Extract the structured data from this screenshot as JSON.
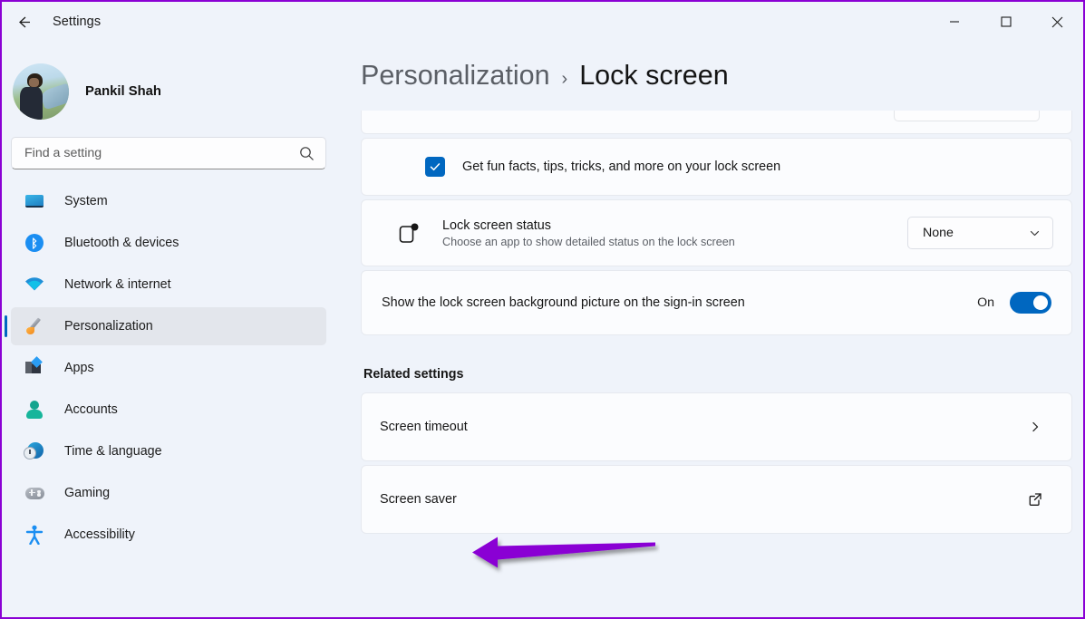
{
  "window": {
    "title": "Settings",
    "back_icon": "back-arrow-icon",
    "minimize_label": "—",
    "maximize_label": "□",
    "close_label": "✕"
  },
  "sidebar": {
    "profile": {
      "name": "Pankil Shah",
      "avatar": "user-avatar"
    },
    "search": {
      "placeholder": "Find a setting",
      "value": "",
      "icon": "search-icon"
    },
    "items": [
      {
        "label": "System",
        "icon": "system-icon",
        "active": false
      },
      {
        "label": "Bluetooth & devices",
        "icon": "bluetooth-icon",
        "active": false
      },
      {
        "label": "Network & internet",
        "icon": "wifi-icon",
        "active": false
      },
      {
        "label": "Personalization",
        "icon": "paintbrush-icon",
        "active": true
      },
      {
        "label": "Apps",
        "icon": "apps-icon",
        "active": false
      },
      {
        "label": "Accounts",
        "icon": "account-icon",
        "active": false
      },
      {
        "label": "Time & language",
        "icon": "clock-globe-icon",
        "active": false
      },
      {
        "label": "Gaming",
        "icon": "gamepad-icon",
        "active": false
      },
      {
        "label": "Accessibility",
        "icon": "accessibility-icon",
        "active": false
      }
    ]
  },
  "breadcrumb": {
    "parent": "Personalization",
    "separator": "›",
    "current": "Lock screen"
  },
  "main": {
    "fun_facts": {
      "label": "Get fun facts, tips, tricks, and more on your lock screen",
      "checked": true
    },
    "lock_screen_status": {
      "title": "Lock screen status",
      "subtitle": "Choose an app to show detailed status on the lock screen",
      "icon": "app-badge-icon",
      "dropdown_value": "None",
      "dropdown_icon": "chevron-down-icon"
    },
    "signin_background": {
      "label": "Show the lock screen background picture on the sign-in screen",
      "state_label": "On",
      "toggle_on": true
    },
    "related_settings_heading": "Related settings",
    "related": [
      {
        "label": "Screen timeout",
        "icon": "chevron-right-icon",
        "kind": "navigate"
      },
      {
        "label": "Screen saver",
        "icon": "external-link-icon",
        "kind": "external"
      }
    ]
  },
  "annotation": {
    "arrow_color": "#8a00d4",
    "points_to": "Screen saver"
  },
  "colors": {
    "accent": "#0067c0",
    "page_bg": "#eff3fa",
    "card_bg": "#fbfcfe",
    "frame": "#8a00d4"
  }
}
